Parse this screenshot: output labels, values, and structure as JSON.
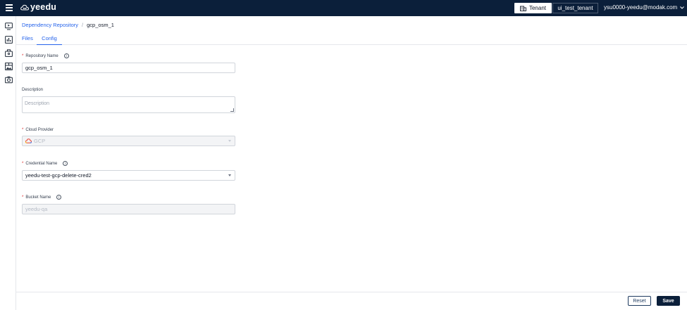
{
  "header": {
    "logo_text": "yeedu",
    "tenant_label": "Tenant",
    "tenant_name": "ui_test_tenant",
    "user_email": "ysu0000-yeedu@modak.com"
  },
  "sidebar": {
    "items": [
      "monitor-icon",
      "chart-icon",
      "briefcase-icon",
      "image-grid-icon",
      "camera-icon"
    ]
  },
  "breadcrumb": {
    "parent": "Dependency Repository",
    "separator": "/",
    "current": "gcp_osm_1"
  },
  "tabs": [
    {
      "label": "Files",
      "active": false
    },
    {
      "label": "Config",
      "active": true
    }
  ],
  "form": {
    "repository_name": {
      "label": "Repository Name",
      "required": true,
      "value": "gcp_osm_1"
    },
    "description": {
      "label": "Description",
      "required": false,
      "value": "",
      "placeholder": "Description"
    },
    "cloud_provider": {
      "label": "Cloud Provider",
      "required": true,
      "value": "GCP",
      "disabled": true
    },
    "credential_name": {
      "label": "Credential Name",
      "required": true,
      "value": "yeedu-test-gcp-delete-cred2"
    },
    "bucket_name": {
      "label": "Bucket Name",
      "required": true,
      "value": "yeedu-qa",
      "disabled": true
    }
  },
  "footer": {
    "reset_label": "Reset",
    "save_label": "Save"
  },
  "colors": {
    "topbar": "#0b1f3a",
    "link": "#2563eb",
    "required": "#dc2626"
  }
}
